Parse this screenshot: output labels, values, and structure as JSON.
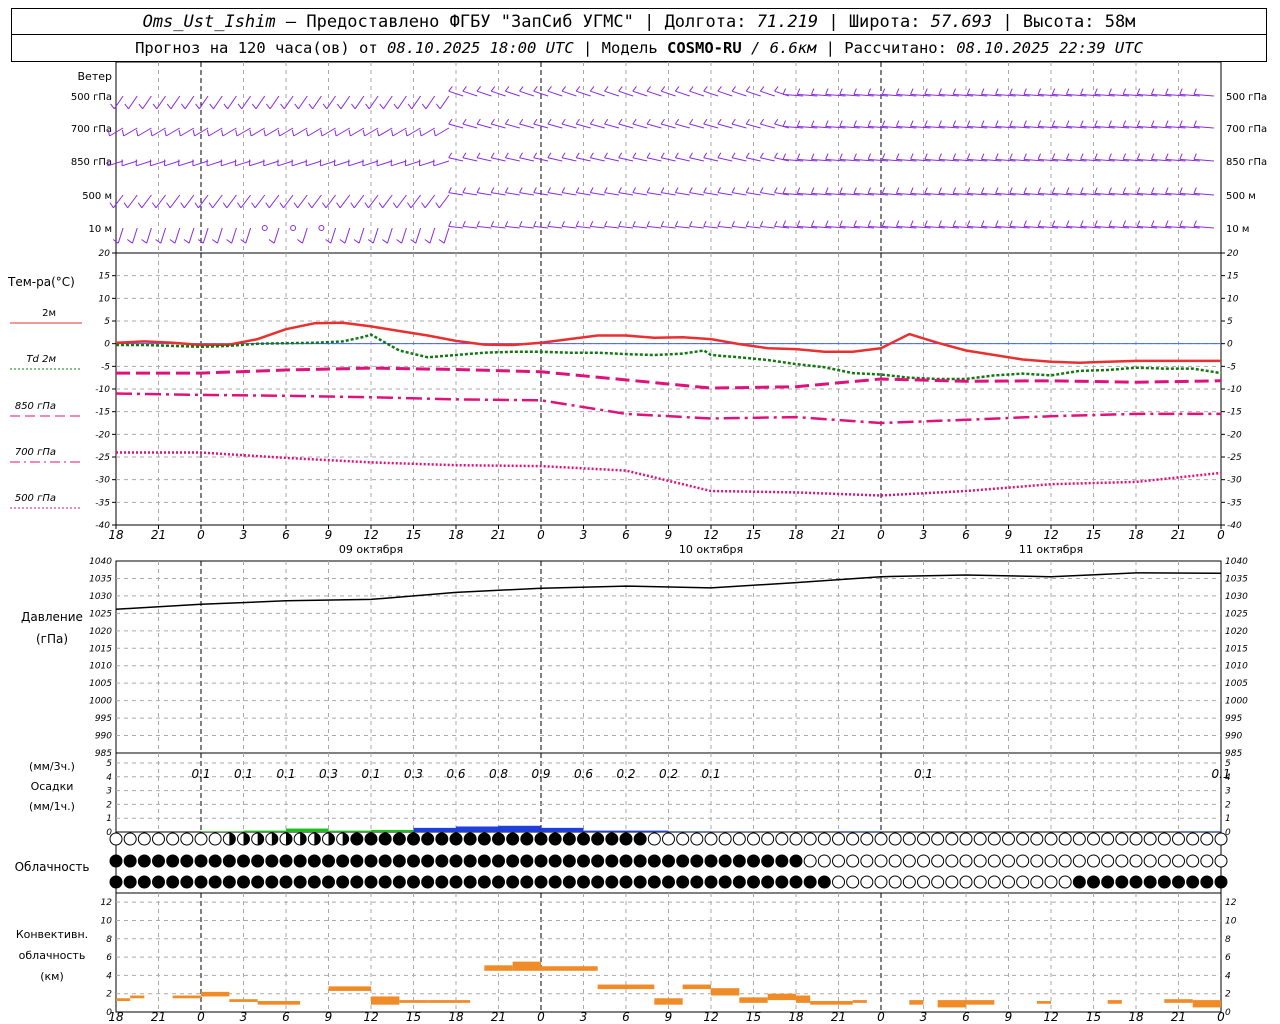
{
  "header": {
    "line1": {
      "station": "Oms_Ust_Ishim",
      "provider": " – Предоставлено ФГБУ \"ЗапСиб УГМС\" | Долгота: ",
      "lon": "71.219",
      "lat_label": " | Широта: ",
      "lat": "57.693",
      "alt_label": " | Высота: 58м"
    },
    "line2": {
      "forecast_label": "Прогноз на 120 часа(ов) от ",
      "forecast_time": "08.10.2025 18:00 UTC",
      "model_label": " | Модель ",
      "model_name": "COSMO-RU",
      "model_res": " / 6.6км",
      "calc_label": " | Рассчитано: ",
      "calc_time": "08.10.2025 22:39 UTC"
    }
  },
  "colors": {
    "wind": "#8a2be2",
    "t2m": "#e83030",
    "td2m": "#127812",
    "t850": "#e0117d",
    "t700": "#e0117d",
    "t500": "#e0117d",
    "pressure": "#000000",
    "precip_blue": "#1f3fd8",
    "precip_green": "#22bb22",
    "convective": "#f08c28",
    "grid": "#aaaaaa"
  },
  "x_axis": {
    "tick_labels": [
      "18",
      "21",
      "0",
      "3",
      "6",
      "9",
      "12",
      "15",
      "18",
      "21",
      "0",
      "3",
      "6",
      "9",
      "12",
      "15",
      "18",
      "21",
      "0",
      "3",
      "6",
      "9",
      "12",
      "15",
      "18",
      "21",
      "0"
    ],
    "day_labels": [
      "09 октября",
      "10 октября",
      "11 октября"
    ]
  },
  "wind_panel": {
    "title": "Ветер",
    "levels": [
      "500 гПа",
      "700 гПа",
      "850 гПа",
      "500 м",
      "10 м"
    ],
    "right_levels": [
      "500 гПа",
      "700 гПа",
      "850 гПа",
      "500 м",
      "10 м"
    ]
  },
  "temp_panel": {
    "title": "Тем-ра(°С)",
    "legend": [
      {
        "label": "2м",
        "key": "t2m",
        "style": "solid"
      },
      {
        "label": "Td  2м",
        "key": "td2m",
        "style": "dotted"
      },
      {
        "label": "850 гПа",
        "key": "t850",
        "style": "dashed"
      },
      {
        "label": "700 гПа",
        "key": "t700",
        "style": "dashdot"
      },
      {
        "label": "500 гПа",
        "key": "t500",
        "style": "dotted"
      }
    ]
  },
  "pressure_panel": {
    "title_line1": "Давление",
    "title_line2": "(гПа)"
  },
  "precip_panel": {
    "title_line1": "(мм/3ч.)",
    "title_line2": "Осадки",
    "title_line3": "(мм/1ч.)",
    "totals": [
      {
        "h": 6,
        "v": "0.1"
      },
      {
        "h": 9,
        "v": "0.1"
      },
      {
        "h": 12,
        "v": "0.1"
      },
      {
        "h": 15,
        "v": "0.3"
      },
      {
        "h": 18,
        "v": "0.1"
      },
      {
        "h": 21,
        "v": "0.3"
      },
      {
        "h": 24,
        "v": "0.6"
      },
      {
        "h": 27,
        "v": "0.8"
      },
      {
        "h": 30,
        "v": "0.9"
      },
      {
        "h": 33,
        "v": "0.6"
      },
      {
        "h": 36,
        "v": "0.2"
      },
      {
        "h": 39,
        "v": "0.2"
      },
      {
        "h": 42,
        "v": "0.1"
      },
      {
        "h": 57,
        "v": "0.1"
      },
      {
        "h": 78,
        "v": "0.1"
      }
    ]
  },
  "cloud_panel": {
    "title": "Облачность"
  },
  "conv_panel": {
    "title_line1": "Конвективн.",
    "title_line2": "облачность",
    "title_line3": "(км)"
  },
  "chart_data": [
    {
      "type": "line",
      "title": "Тем-ра(°С)",
      "x_unit": "hours from 08.10.2025 18:00 UTC",
      "ylim": [
        -40,
        20
      ],
      "yticks": [
        -40,
        -35,
        -30,
        -25,
        -20,
        -15,
        -10,
        -5,
        0,
        5,
        10,
        15,
        20
      ],
      "grid": true,
      "series": [
        {
          "name": "2м",
          "x": [
            0,
            2,
            4,
            6,
            8,
            10,
            12,
            14,
            16,
            18,
            20,
            22,
            24,
            26,
            28,
            30,
            32,
            34,
            36,
            38,
            40,
            42,
            44,
            46,
            48,
            50,
            52,
            54,
            56,
            58,
            60,
            62,
            64,
            66,
            68,
            70,
            72,
            74,
            76,
            78
          ],
          "values": [
            0.2,
            0.5,
            0.2,
            -0.3,
            -0.2,
            1,
            3.2,
            4.5,
            4.6,
            3.8,
            2.8,
            1.8,
            0.6,
            -0.2,
            -0.3,
            0.2,
            1,
            1.8,
            1.8,
            1.3,
            1.4,
            1,
            -0.1,
            -1,
            -1.2,
            -1.8,
            -1.8,
            -1,
            2.1,
            0.2,
            -1.5,
            -2.5,
            -3.5,
            -4,
            -4.2,
            -4,
            -3.8,
            -3.8,
            -3.8,
            -3.8
          ]
        },
        {
          "name": "Td  2м",
          "x": [
            0,
            2,
            4,
            6,
            8,
            10,
            12,
            14,
            16,
            17.5,
            18,
            20,
            22,
            24,
            26,
            28,
            30,
            32,
            34,
            36,
            38,
            40,
            41.5,
            42,
            44,
            46,
            48,
            50,
            52,
            54,
            56,
            58,
            60,
            62,
            64,
            66,
            68,
            70,
            72,
            74,
            76,
            78
          ],
          "values": [
            -0.3,
            -0.3,
            -0.5,
            -0.7,
            -0.5,
            0,
            0.1,
            0.2,
            0.5,
            1.5,
            2,
            -1.5,
            -3,
            -2.5,
            -2,
            -1.8,
            -1.8,
            -2,
            -2,
            -2.3,
            -2.5,
            -2.2,
            -1.5,
            -2.5,
            -3,
            -3.6,
            -4.5,
            -5.2,
            -6.5,
            -6.8,
            -7.5,
            -7.8,
            -7.8,
            -7,
            -6.6,
            -7,
            -6,
            -5.8,
            -5.3,
            -5.5,
            -5.5,
            -6.5
          ]
        },
        {
          "name": "850 гПа",
          "x": [
            0,
            6,
            12,
            18,
            24,
            30,
            36,
            42,
            48,
            54,
            60,
            66,
            72,
            78
          ],
          "values": [
            -6.5,
            -6.5,
            -5.8,
            -5.4,
            -5.7,
            -6.2,
            -8,
            -9.8,
            -9.5,
            -7.8,
            -8.3,
            -8.2,
            -8.5,
            -8.2
          ]
        },
        {
          "name": "700 гПа",
          "x": [
            0,
            6,
            12,
            18,
            24,
            30,
            36,
            42,
            48,
            54,
            60,
            66,
            72,
            78
          ],
          "values": [
            -11,
            -11.3,
            -11.5,
            -11.8,
            -12.3,
            -12.5,
            -15.5,
            -16.5,
            -16.2,
            -17.5,
            -16.8,
            -16,
            -15.5,
            -15.5
          ]
        },
        {
          "name": "500 гПа",
          "x": [
            0,
            6,
            12,
            18,
            24,
            30,
            36,
            42,
            48,
            54,
            60,
            66,
            72,
            78
          ],
          "values": [
            -24,
            -24,
            -25.2,
            -26.2,
            -26.8,
            -27,
            -28,
            -32.5,
            -32.8,
            -33.5,
            -32.5,
            -31,
            -30.5,
            -28.5
          ]
        }
      ]
    },
    {
      "type": "line",
      "title": "Давление",
      "ylabel": "(гПа)",
      "ylim": [
        985,
        1040
      ],
      "yticks": [
        985,
        990,
        995,
        1000,
        1005,
        1010,
        1015,
        1020,
        1025,
        1030,
        1035,
        1040
      ],
      "series": [
        {
          "name": "Давление",
          "x": [
            0,
            6,
            12,
            18,
            24,
            30,
            36,
            42,
            48,
            54,
            60,
            66,
            72,
            78
          ],
          "values": [
            1026.2,
            1027.6,
            1028.6,
            1029,
            1031,
            1032.2,
            1032.8,
            1032.3,
            1033.8,
            1035.5,
            1036,
            1035.5,
            1036.6,
            1036.5
          ]
        }
      ]
    },
    {
      "type": "bar",
      "title": "Осадки",
      "ylabel": "(мм/1ч.)",
      "ylim": [
        0,
        5
      ],
      "yticks": [
        0,
        1,
        2,
        3,
        4,
        5
      ],
      "x": [
        9,
        12,
        15,
        18,
        21,
        24,
        27,
        30,
        33,
        36,
        39,
        42,
        45,
        54,
        78
      ],
      "values": [
        0.05,
        0.1,
        0.25,
        0.1,
        0.15,
        0.3,
        0.4,
        0.45,
        0.3,
        0.1,
        0.1,
        0.05,
        0.02,
        0.05,
        0.05
      ]
    },
    {
      "type": "bar",
      "title": "Конвективн. облачность (км)",
      "ylim": [
        0,
        13
      ],
      "yticks": [
        0,
        2,
        4,
        6,
        8,
        10,
        12
      ],
      "segments": [
        {
          "x0": 0,
          "x1": 1,
          "bottom": 1.2,
          "top": 1.5
        },
        {
          "x0": 1,
          "x1": 2,
          "bottom": 1.5,
          "top": 1.8
        },
        {
          "x0": 4,
          "x1": 6,
          "bottom": 1.5,
          "top": 1.8
        },
        {
          "x0": 6,
          "x1": 8,
          "bottom": 1.7,
          "top": 2.2
        },
        {
          "x0": 8,
          "x1": 10,
          "bottom": 1.1,
          "top": 1.4
        },
        {
          "x0": 10,
          "x1": 13,
          "bottom": 0.8,
          "top": 1.2
        },
        {
          "x0": 15,
          "x1": 18,
          "bottom": 2.3,
          "top": 2.8
        },
        {
          "x0": 18,
          "x1": 20,
          "bottom": 0.8,
          "top": 1.7
        },
        {
          "x0": 20,
          "x1": 22,
          "bottom": 1.0,
          "top": 1.3
        },
        {
          "x0": 22,
          "x1": 25,
          "bottom": 1.0,
          "top": 1.3
        },
        {
          "x0": 26,
          "x1": 28,
          "bottom": 4.5,
          "top": 5.1
        },
        {
          "x0": 28,
          "x1": 30,
          "bottom": 4.5,
          "top": 5.5
        },
        {
          "x0": 30,
          "x1": 34,
          "bottom": 4.5,
          "top": 5.0
        },
        {
          "x0": 34,
          "x1": 38,
          "bottom": 2.5,
          "top": 3.0
        },
        {
          "x0": 38,
          "x1": 40,
          "bottom": 0.8,
          "top": 1.5
        },
        {
          "x0": 40,
          "x1": 42,
          "bottom": 2.5,
          "top": 3.0
        },
        {
          "x0": 42,
          "x1": 44,
          "bottom": 1.8,
          "top": 2.6
        },
        {
          "x0": 44,
          "x1": 46,
          "bottom": 1.0,
          "top": 1.6
        },
        {
          "x0": 46,
          "x1": 48,
          "bottom": 1.3,
          "top": 2.0
        },
        {
          "x0": 48,
          "x1": 49,
          "bottom": 1.0,
          "top": 1.8
        },
        {
          "x0": 49,
          "x1": 52,
          "bottom": 0.8,
          "top": 1.2
        },
        {
          "x0": 52,
          "x1": 53,
          "bottom": 1.0,
          "top": 1.3
        },
        {
          "x0": 56,
          "x1": 57,
          "bottom": 0.8,
          "top": 1.3
        },
        {
          "x0": 58,
          "x1": 60,
          "bottom": 0.5,
          "top": 1.3
        },
        {
          "x0": 60,
          "x1": 62,
          "bottom": 0.8,
          "top": 1.3
        },
        {
          "x0": 65,
          "x1": 66,
          "bottom": 0.9,
          "top": 1.2
        },
        {
          "x0": 70,
          "x1": 71,
          "bottom": 0.9,
          "top": 1.3
        },
        {
          "x0": 74,
          "x1": 76,
          "bottom": 1.0,
          "top": 1.4
        },
        {
          "x0": 76,
          "x1": 78,
          "bottom": 0.5,
          "top": 1.3
        }
      ]
    }
  ]
}
